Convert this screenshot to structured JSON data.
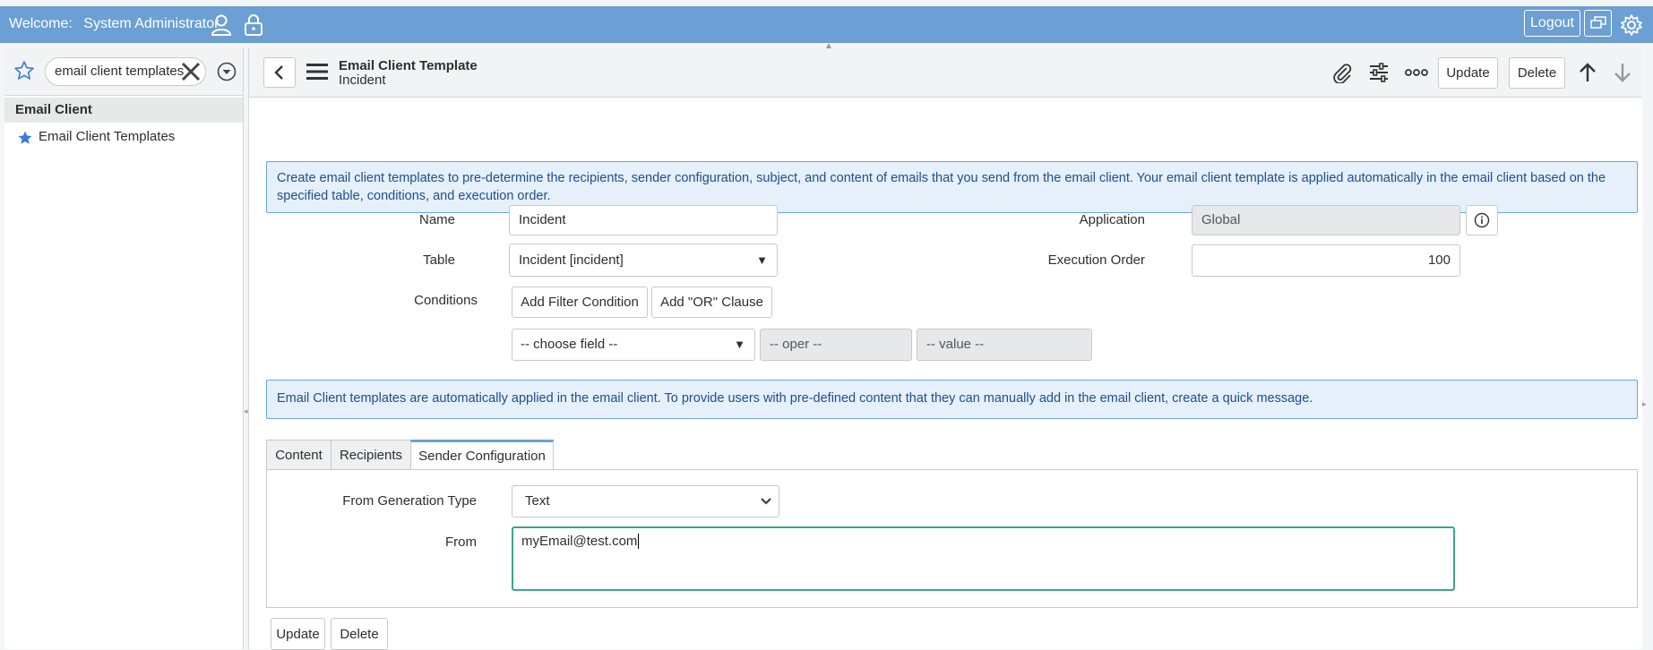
{
  "topbar": {
    "welcome_label": "Welcome:",
    "user_name": "System Administrator",
    "logout_label": "Logout"
  },
  "nav": {
    "search_value": "email client templates",
    "app_title": "Email Client",
    "modules": [
      {
        "label": "Email Client Templates"
      }
    ]
  },
  "header": {
    "title": "Email Client Template",
    "subtitle": "Incident",
    "update_label": "Update",
    "delete_label": "Delete"
  },
  "info_top": "Create email client templates to pre-determine the recipients, sender configuration, subject, and content of emails that you send from the email client. Your email client template is applied automatically in the email client based on the specified table, conditions, and execution order.",
  "form": {
    "name_label": "Name",
    "name_value": "Incident",
    "table_label": "Table",
    "table_value": "Incident [incident]",
    "conditions_label": "Conditions",
    "add_filter_label": "Add Filter Condition",
    "add_or_label": "Add \"OR\" Clause",
    "choose_field": "-- choose field --",
    "oper": "-- oper --",
    "value": "-- value --",
    "application_label": "Application",
    "application_value": "Global",
    "execution_order_label": "Execution Order",
    "execution_order_value": "100"
  },
  "info_bottom": "Email Client templates are automatically applied in the email client. To provide users with pre-defined content that they can manually add in the email client, create a quick message.",
  "tabs": [
    {
      "label": "Content"
    },
    {
      "label": "Recipients"
    },
    {
      "label": "Sender Configuration"
    }
  ],
  "sender": {
    "from_gen_label": "From Generation Type",
    "from_gen_value": "Text",
    "from_label": "From",
    "from_value": "myEmail@test.com"
  },
  "footer": {
    "update_label": "Update",
    "delete_label": "Delete"
  },
  "colors": {
    "topbar": "#6c9fd3",
    "info_bg": "#e5f0fb",
    "info_border": "#6aa6de",
    "focus": "#3ba58b"
  }
}
